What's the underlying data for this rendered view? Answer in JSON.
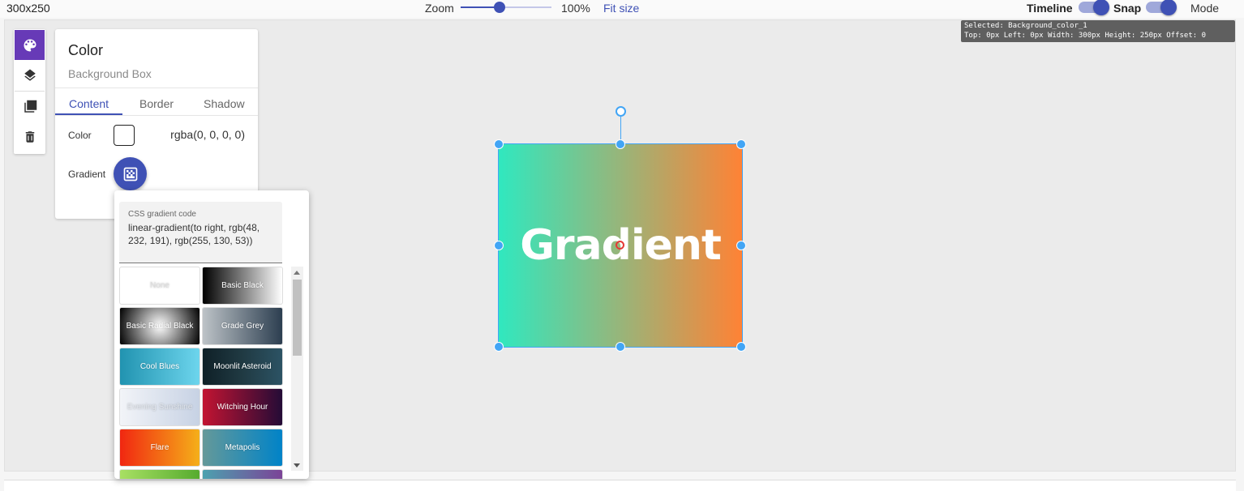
{
  "topbar": {
    "canvas_size": "300x250",
    "zoom_label": "Zoom",
    "zoom_value": "100%",
    "zoom_fraction": 0.43,
    "fit_size": "Fit size",
    "timeline_label": "Timeline",
    "timeline_on": true,
    "snap_label": "Snap",
    "snap_on": true,
    "mode_label": "Mode"
  },
  "info": {
    "line1": "Selected: Background_color_1",
    "line2": "Top: 0px Left: 0px Width: 300px Height: 250px Offset: 0"
  },
  "tools": [
    "palette-icon",
    "layers-icon",
    "copy-icon",
    "delete-icon"
  ],
  "panel": {
    "title": "Color",
    "subtitle": "Background Box",
    "tabs": [
      "Content",
      "Border",
      "Shadow"
    ],
    "active_tab": "Content",
    "color_label": "Color",
    "color_value": "rgba(0, 0, 0, 0)",
    "gradient_label": "Gradient"
  },
  "popover": {
    "css_label": "CSS gradient code",
    "css_value": "linear-gradient(to right, rgb(48, 232, 191), rgb(255, 130, 53))",
    "presets": [
      {
        "name": "None",
        "background": "#ffffff",
        "text_color": "#dddddd"
      },
      {
        "name": "Basic Black",
        "background": "linear-gradient(to right, #000000, #ffffff)",
        "text_color": "#ffffff"
      },
      {
        "name": "Basic Radial Black",
        "background": "radial-gradient(circle, #ffffff 0%, #000000 100%)",
        "text_color": "#ffffff"
      },
      {
        "name": "Grade Grey",
        "background": "linear-gradient(to right, #bdc3c7, #2c3e50)",
        "text_color": "#ffffff"
      },
      {
        "name": "Cool Blues",
        "background": "linear-gradient(to right, #2193b0, #6dd5ed)",
        "text_color": "#ffffff"
      },
      {
        "name": "Moonlit Asteroid",
        "background": "linear-gradient(to right, #0f2027, #203a43, #2c5364)",
        "text_color": "#ffffff"
      },
      {
        "name": "Evening Sunshine",
        "background": "linear-gradient(to right, #f2f4f8, #c7d2e4)",
        "text_color": "#e0e4ea"
      },
      {
        "name": "Witching Hour",
        "background": "linear-gradient(to right, #c31432, #240b36)",
        "text_color": "#ffffff"
      },
      {
        "name": "Flare",
        "background": "linear-gradient(to right, #f12711, #f5af19)",
        "text_color": "#ffffff"
      },
      {
        "name": "Metapolis",
        "background": "linear-gradient(to right, #659999, #0083c8)",
        "text_color": "#ffffff"
      },
      {
        "name": "",
        "background": "linear-gradient(to right, #a8e063, #56ab2f)",
        "text_color": "#ffffff"
      },
      {
        "name": "",
        "background": "linear-gradient(to right, #4ca1af, #7b4397)",
        "text_color": "#ffffff"
      }
    ]
  },
  "canvas": {
    "text": "Gradient",
    "gradient": "linear-gradient(to right, rgb(48, 232, 191), rgb(255, 130, 53))"
  },
  "colors": {
    "accent": "#3f51b5",
    "tool_active": "#673ab7",
    "selection": "#42a5f5"
  }
}
